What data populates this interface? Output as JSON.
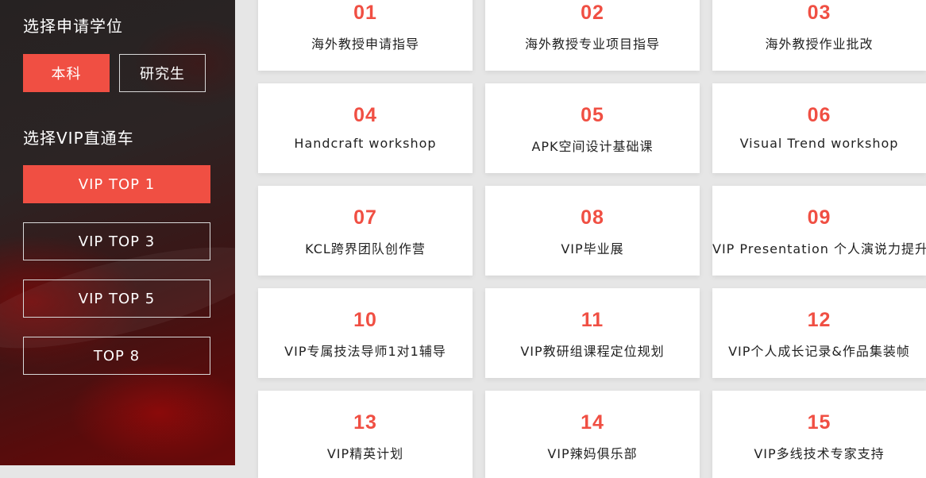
{
  "sidebar": {
    "degree_heading": "选择申请学位",
    "degree_options": [
      {
        "label": "本科",
        "active": true
      },
      {
        "label": "研究生",
        "active": false
      }
    ],
    "vip_heading": "选择VIP直通车",
    "vip_options": [
      {
        "label": "VIP TOP 1",
        "active": true
      },
      {
        "label": "VIP TOP 3",
        "active": false
      },
      {
        "label": "VIP TOP 5",
        "active": false
      },
      {
        "label": "TOP 8",
        "active": false
      }
    ]
  },
  "cards": [
    {
      "num": "01",
      "title": "海外教授申请指导"
    },
    {
      "num": "02",
      "title": "海外教授专业项目指导"
    },
    {
      "num": "03",
      "title": "海外教授作业批改"
    },
    {
      "num": "04",
      "title": "Handcraft workshop"
    },
    {
      "num": "05",
      "title": "APK空间设计基础课"
    },
    {
      "num": "06",
      "title": "Visual Trend workshop"
    },
    {
      "num": "07",
      "title": "KCL跨界团队创作营"
    },
    {
      "num": "08",
      "title": "VIP毕业展"
    },
    {
      "num": "09",
      "title": "VIP Presentation 个人演说力提升"
    },
    {
      "num": "10",
      "title": "VIP专属技法导师1对1辅导"
    },
    {
      "num": "11",
      "title": "VIP教研组课程定位规划"
    },
    {
      "num": "12",
      "title": "VIP个人成长记录&作品集装帧"
    },
    {
      "num": "13",
      "title": "VIP精英计划"
    },
    {
      "num": "14",
      "title": "VIP辣妈俱乐部"
    },
    {
      "num": "15",
      "title": "VIP多线技术专家支持"
    }
  ],
  "colors": {
    "accent": "#f04f43",
    "sidebar_dark": "#262222"
  }
}
